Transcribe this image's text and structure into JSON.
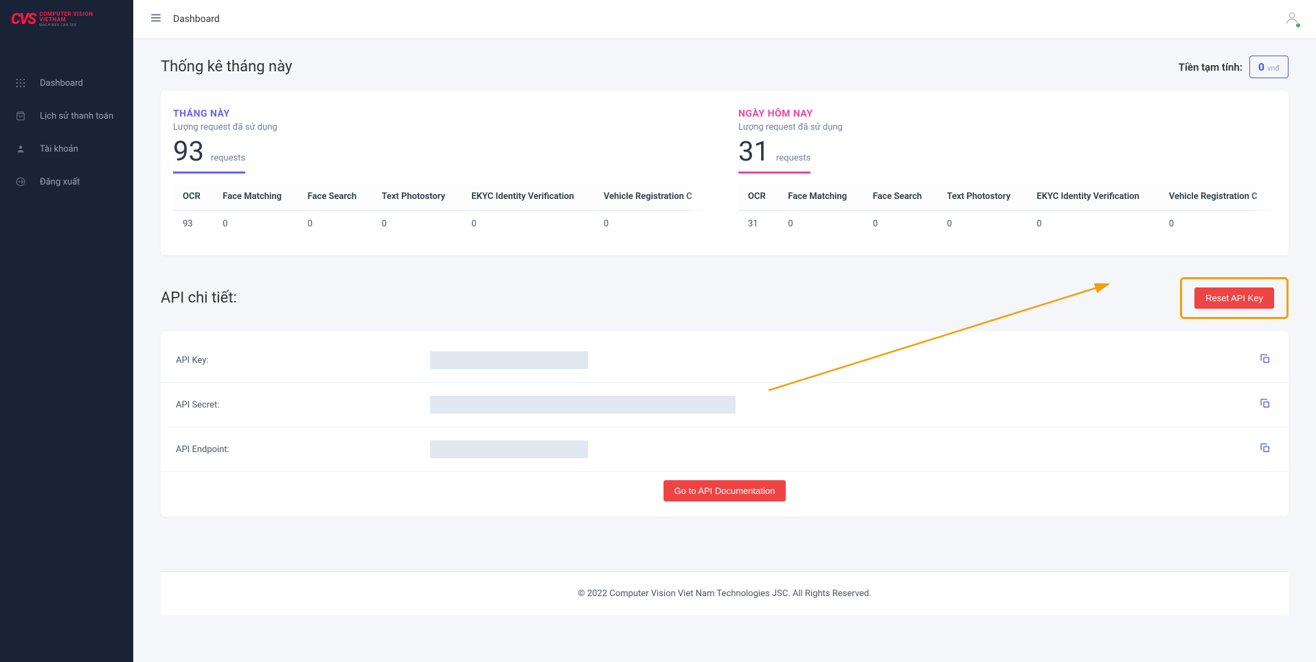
{
  "brand": {
    "mark": "CVS",
    "line1": "COMPUTER VISION",
    "line2": "VIETNAM",
    "tagline": "MACHINES CAN SEE"
  },
  "topbar": {
    "page": "Dashboard"
  },
  "sidebar": {
    "items": [
      {
        "label": "Dashboard"
      },
      {
        "label": "Lịch sử thanh toán"
      },
      {
        "label": "Tài khoản"
      },
      {
        "label": "Đăng xuất"
      }
    ]
  },
  "stats": {
    "title": "Thống kê tháng này",
    "balance_label": "Tiền tạm tính:",
    "balance_value": "0",
    "balance_unit": "vnđ",
    "month": {
      "title": "THÁNG NÀY",
      "subtitle": "Lượng request đã sử dụng",
      "value": "93",
      "unit": "requests",
      "columns": [
        "OCR",
        "Face Matching",
        "Face Search",
        "Text Photostory",
        "EKYC Identity Verification",
        "Vehicle Registration C"
      ],
      "row": [
        "93",
        "0",
        "0",
        "0",
        "0",
        "0"
      ]
    },
    "today": {
      "title": "NGÀY HÔM NAY",
      "subtitle": "Lượng request đã sử dụng",
      "value": "31",
      "unit": "requests",
      "columns": [
        "OCR",
        "Face Matching",
        "Face Search",
        "Text Photostory",
        "EKYC Identity Verification",
        "Vehicle Registration C"
      ],
      "row": [
        "31",
        "0",
        "0",
        "0",
        "0",
        "0"
      ]
    }
  },
  "api": {
    "title": "API chi tiết:",
    "reset_button": "Reset API Key",
    "key_label": "API Key:",
    "secret_label": "API Secret:",
    "endpoint_label": "API Endpoint:",
    "doc_button": "Go to API Documentation"
  },
  "footer": "© 2022 Computer Vision Viet Nam Technologies JSC. All Rights Reserved."
}
